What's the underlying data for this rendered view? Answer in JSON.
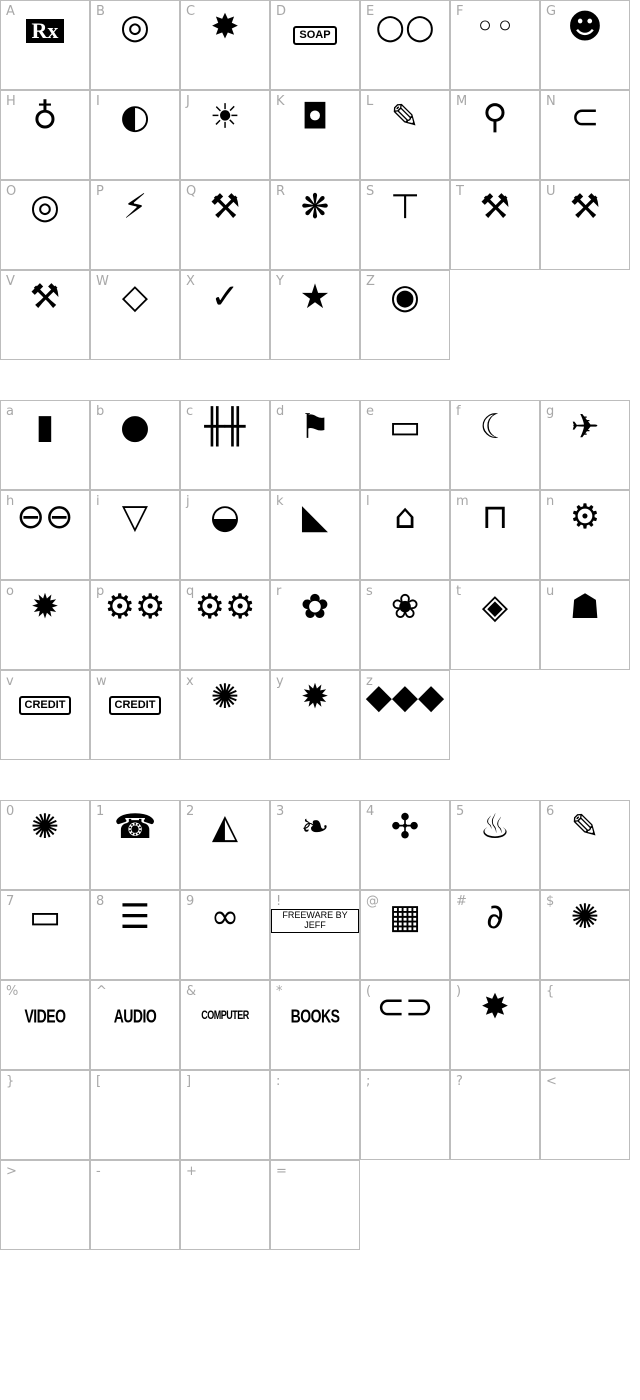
{
  "sections": [
    {
      "cells": [
        {
          "label": "A",
          "icon": "rx-pill-icon",
          "text": "Rx",
          "style": "boxblk"
        },
        {
          "label": "B",
          "icon": "compact-disc-icon",
          "glyph": "◎"
        },
        {
          "label": "C",
          "icon": "firecracker-icon",
          "glyph": "✸"
        },
        {
          "label": "D",
          "icon": "soap-icon",
          "text": "SOAP",
          "style": "box"
        },
        {
          "label": "E",
          "icon": "lorgnette-icon",
          "glyph": "○○"
        },
        {
          "label": "F",
          "icon": "eyeglasses-icon",
          "glyph": "◦◦"
        },
        {
          "label": "G",
          "icon": "clown-icon",
          "glyph": "☻"
        },
        {
          "label": "H",
          "icon": "lightbulb-icon",
          "glyph": "♁"
        },
        {
          "label": "I",
          "icon": "moon-icon",
          "glyph": "◐"
        },
        {
          "label": "J",
          "icon": "sun-icon",
          "glyph": "☀"
        },
        {
          "label": "K",
          "icon": "wristwatch-icon",
          "glyph": "◘"
        },
        {
          "label": "L",
          "icon": "notepad-pencil-icon",
          "glyph": "✎"
        },
        {
          "label": "M",
          "icon": "lollipop-icon",
          "glyph": "⚲"
        },
        {
          "label": "N",
          "icon": "paperclip-icon",
          "glyph": "⊂"
        },
        {
          "label": "O",
          "icon": "disc-stack-icon",
          "glyph": "◎"
        },
        {
          "label": "P",
          "icon": "lightning-icon",
          "glyph": "⚡"
        },
        {
          "label": "Q",
          "icon": "pickaxe-icon",
          "glyph": "⚒"
        },
        {
          "label": "R",
          "icon": "spiderweb-icon",
          "glyph": "❋"
        },
        {
          "label": "S",
          "icon": "tshirt-icon",
          "glyph": "⊤"
        },
        {
          "label": "T",
          "icon": "wrench-icon",
          "glyph": "⚒"
        },
        {
          "label": "U",
          "icon": "spanner-icon",
          "glyph": "⚒"
        },
        {
          "label": "V",
          "icon": "hammer-icon",
          "glyph": "⚒"
        },
        {
          "label": "W",
          "icon": "diamond-icon",
          "glyph": "◇"
        },
        {
          "label": "X",
          "icon": "pencil-check-icon",
          "glyph": "✓"
        },
        {
          "label": "Y",
          "icon": "star-icon",
          "glyph": "★"
        },
        {
          "label": "Z",
          "icon": "eye-icon",
          "glyph": "◉"
        }
      ]
    },
    {
      "cells": [
        {
          "label": "a",
          "icon": "remote-control-icon",
          "glyph": "▮"
        },
        {
          "label": "b",
          "icon": "ball-icon",
          "glyph": "●"
        },
        {
          "label": "c",
          "icon": "fence-icon",
          "glyph": "╫╫"
        },
        {
          "label": "d",
          "icon": "signpost-icon",
          "glyph": "⚑"
        },
        {
          "label": "e",
          "icon": "sign-board-icon",
          "glyph": "▭"
        },
        {
          "label": "f",
          "icon": "ufo-icon",
          "glyph": "☾"
        },
        {
          "label": "g",
          "icon": "surfer-icon",
          "glyph": "✈"
        },
        {
          "label": "h",
          "icon": "barbell-icon",
          "glyph": "⊖⊖"
        },
        {
          "label": "i",
          "icon": "boat-icon",
          "glyph": "▽"
        },
        {
          "label": "j",
          "icon": "hamburger-icon",
          "glyph": "◒"
        },
        {
          "label": "k",
          "icon": "pizza-slice-icon",
          "glyph": "◣"
        },
        {
          "label": "l",
          "icon": "radio-icon",
          "glyph": "⌂"
        },
        {
          "label": "m",
          "icon": "press-icon",
          "glyph": "⊓"
        },
        {
          "label": "n",
          "icon": "gear-icon",
          "glyph": "⚙"
        },
        {
          "label": "o",
          "icon": "sunburst-icon",
          "glyph": "✹"
        },
        {
          "label": "p",
          "icon": "two-gears-icon",
          "glyph": "⚙⚙"
        },
        {
          "label": "q",
          "icon": "three-gears-icon",
          "glyph": "⚙⚙"
        },
        {
          "label": "r",
          "icon": "potted-plant-icon",
          "glyph": "✿"
        },
        {
          "label": "s",
          "icon": "flower-icon",
          "glyph": "❀"
        },
        {
          "label": "t",
          "icon": "rug-pattern-icon",
          "glyph": "◈"
        },
        {
          "label": "u",
          "icon": "ghost-icon",
          "glyph": "☗"
        },
        {
          "label": "v",
          "icon": "credit-card-icon",
          "text": "CREDIT",
          "style": "box"
        },
        {
          "label": "w",
          "icon": "credit-cards-icon",
          "text": "CREDIT",
          "style": "box"
        },
        {
          "label": "x",
          "icon": "seal-ring-icon",
          "glyph": "✺"
        },
        {
          "label": "y",
          "icon": "seal-burst-icon",
          "glyph": "✹"
        },
        {
          "label": "z",
          "icon": "diamonds-row-icon",
          "glyph": "◆◆◆"
        }
      ]
    },
    {
      "cells": [
        {
          "label": "0",
          "icon": "ring-seal-icon",
          "glyph": "✺"
        },
        {
          "label": "1",
          "icon": "telephone-icon",
          "glyph": "☎"
        },
        {
          "label": "2",
          "icon": "road-icon",
          "glyph": "◭"
        },
        {
          "label": "3",
          "icon": "chili-pepper-icon",
          "glyph": "❧"
        },
        {
          "label": "4",
          "icon": "lizard-icon",
          "glyph": "✣"
        },
        {
          "label": "5",
          "icon": "bottle-icon",
          "glyph": "♨"
        },
        {
          "label": "6",
          "icon": "pencil-sign-icon",
          "glyph": "✎"
        },
        {
          "label": "7",
          "icon": "folders-icon",
          "glyph": "▭"
        },
        {
          "label": "8",
          "icon": "lines-icon",
          "glyph": "☰"
        },
        {
          "label": "9",
          "icon": "wave-divider-icon",
          "glyph": "∞"
        },
        {
          "label": "!",
          "icon": "freeware-banner-icon",
          "text": "FREEWARE BY JEFF",
          "style": "free"
        },
        {
          "label": "@",
          "icon": "brick-wall-icon",
          "glyph": "▦"
        },
        {
          "label": "#",
          "icon": "hook-icon",
          "glyph": "∂"
        },
        {
          "label": "$",
          "icon": "ring-seal-icon",
          "glyph": "✺"
        },
        {
          "label": "%",
          "icon": "video-icon",
          "text": "VIDEO",
          "style": "caps"
        },
        {
          "label": "^",
          "icon": "audio-icon",
          "text": "AUDIO",
          "style": "caps"
        },
        {
          "label": "&",
          "icon": "computer-icon",
          "text": "COMPUTER",
          "style": "caps small"
        },
        {
          "label": "*",
          "icon": "books-icon",
          "text": "BOOKS",
          "style": "caps"
        },
        {
          "label": "(",
          "icon": "chain-icon",
          "glyph": "⊂⊃"
        },
        {
          "label": ")",
          "icon": "starburst-icon",
          "glyph": "✸"
        },
        {
          "label": "{"
        },
        {
          "label": "}"
        },
        {
          "label": "["
        },
        {
          "label": "]"
        },
        {
          "label": ":"
        },
        {
          "label": ";"
        },
        {
          "label": "?"
        },
        {
          "label": "<"
        },
        {
          "label": ">"
        },
        {
          "label": "-"
        },
        {
          "label": "+"
        },
        {
          "label": "="
        }
      ]
    }
  ]
}
